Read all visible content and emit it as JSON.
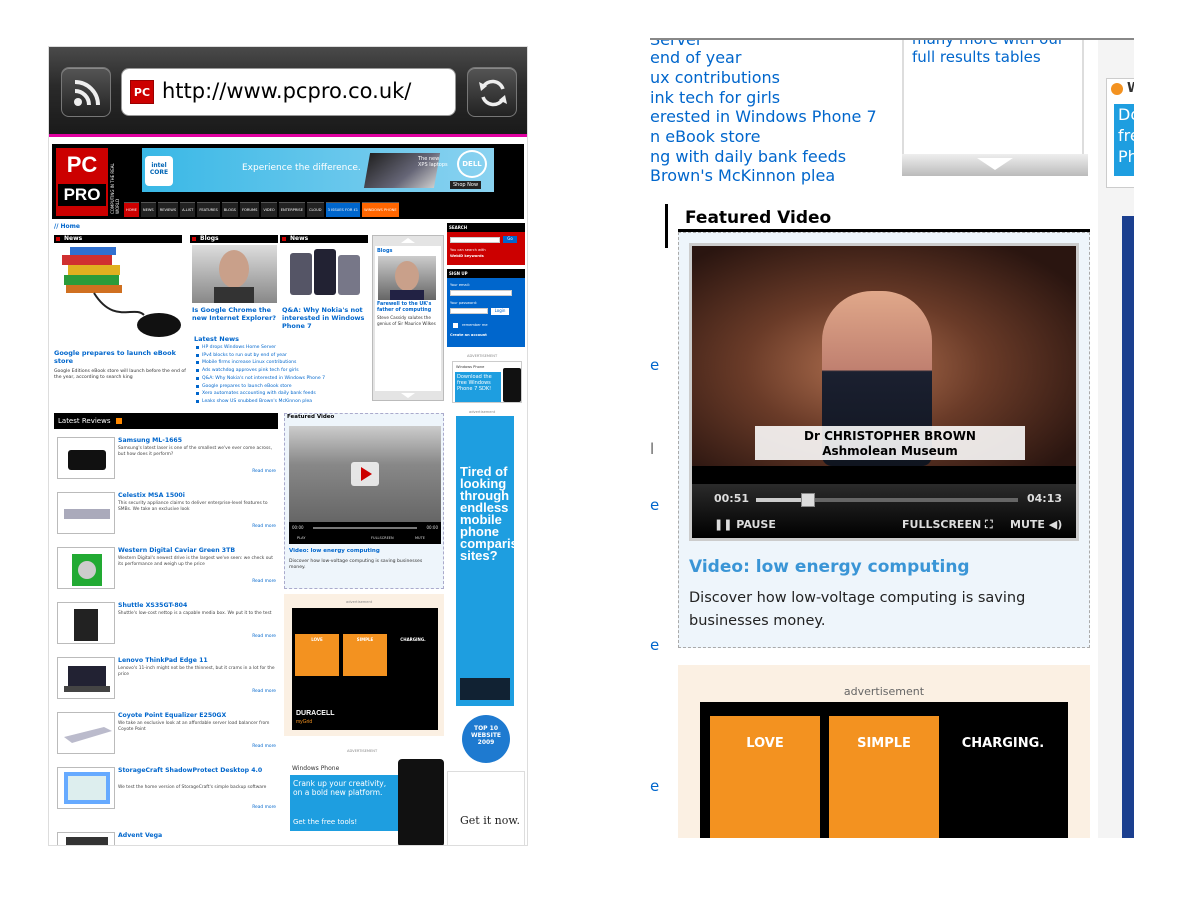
{
  "browser": {
    "url": "http://www.pcpro.co.uk/",
    "favicon_text": "PC"
  },
  "site": {
    "logo_top": "PC",
    "logo_bottom": "PRO",
    "tagline": "COMPUTING IN THE REAL WORLD",
    "banner": {
      "chip": "intel CORE",
      "headline": "Experience the difference.",
      "sub": "The new XPS laptops",
      "brand": "DELL",
      "cta": "Shop Now"
    },
    "nav": [
      "HOME",
      "NEWS",
      "REVIEWS",
      "A-LIST",
      "FEATURES",
      "BLOGS",
      "FORUMS",
      "VIDEO",
      "ENTERPRISE",
      "CLOUD",
      "3 ISSUES FOR £1",
      "WINDOWS PHONE"
    ],
    "breadcrumb": "// Home"
  },
  "news": {
    "heading": "News",
    "lead_title": "Google prepares to launch eBook store",
    "lead_desc": "Google Editions eBook store will launch before the end of the year, according to search king"
  },
  "blogs": {
    "heading": "Blogs",
    "title": "Is Google Chrome the new Internet Explorer?"
  },
  "news2": {
    "heading": "News",
    "title": "Q&A: Why Nokia's not interested in Windows Phone 7"
  },
  "latest_news": {
    "heading": "Latest News",
    "items": [
      "HP drops Windows Home Server",
      "IPv4 blocks to run out by end of year",
      "Mobile firms increase Linux contributions",
      "Ads watchdog approves pink tech for girls",
      "Q&A: Why Nokia's not interested in Windows Phone 7",
      "Google prepares to launch eBook store",
      "Xero automates accounting with daily bank feeds",
      "Leaks show US snubbed Brown's McKinnon plea"
    ]
  },
  "carousel": {
    "heading": "Blogs",
    "title": "Farewell to the UK's father of computing",
    "desc": "Steve Cassidy salutes the genius of Sir Maurice Wilkes"
  },
  "search": {
    "heading": "SEARCH",
    "go": "Go",
    "hint": "You can search with",
    "hint2": "WebID keywords"
  },
  "signup": {
    "heading": "SIGN UP",
    "email_label": "Your email:",
    "password_label": "Your password:",
    "login": "Login",
    "remember": "remember me",
    "create": "Create an account"
  },
  "ads": {
    "label": "ADVERTISEMENT",
    "label_lower": "advertisement",
    "wp_brand": "Windows Phone",
    "wp_small_text": "Download the free Windows Phone 7 SDK!",
    "tired_text": "Tired of looking through endless mobile phone comparison sites?",
    "top10": "TOP 10 WEBSITE",
    "top10_year": "2009",
    "wp_big_text": "Crank up your creativity, on a bold new platform.",
    "wp_big_cta": "Get the free tools!",
    "get_it": "Get it now.",
    "duracell": "DURACELL",
    "duracell_sub": "myGrid",
    "tiles": [
      "LOVE",
      "SIMPLE",
      "CHARGING."
    ]
  },
  "reviews": {
    "heading": "Latest Reviews",
    "read_more": "Read more",
    "items": [
      {
        "title": "Samsung ML-1665",
        "desc": "Samsung's latest laser is one of the smallest we've ever come across, but how does it perform?"
      },
      {
        "title": "Celestix MSA 1500i",
        "desc": "This security appliance claims to deliver enterprise-level features to SMBs. We take an exclusive look"
      },
      {
        "title": "Western Digital Caviar Green 3TB",
        "desc": "Western Digital's newest drive is the largest we've seen: we check out its performance and weigh up the price"
      },
      {
        "title": "Shuttle XS35GT-804",
        "desc": "Shuttle's low-cost nettop is a capable media box. We put it to the test"
      },
      {
        "title": "Lenovo ThinkPad Edge 11",
        "desc": "Lenovo's 11-inch might not be the thinnest, but it crams in a lot for the price"
      },
      {
        "title": "Coyote Point Equalizer E250GX",
        "desc": "We take an exclusive look at an affordable server load balancer from Coyote Point"
      },
      {
        "title": "StorageCraft ShadowProtect Desktop 4.0",
        "desc": "We test the home version of StorageCraft's simple backup software"
      },
      {
        "title": "Advent Vega",
        "desc": ""
      }
    ]
  },
  "featured_video": {
    "heading": "Featured Video",
    "title": "Video: low energy computing",
    "desc": "Discover how low-voltage computing is saving businesses money.",
    "caption_name": "Dr CHRISTOPHER BROWN",
    "caption_org": "Ashmolean Museum",
    "time_elapsed": "00:51",
    "time_total": "04:13",
    "time_elapsed_small": "00:00",
    "time_total_small": "00:00",
    "play": "PLAY",
    "pause": "PAUSE",
    "fullscreen": "FULLSCREEN",
    "mute": "MUTE",
    "progress": 0.2
  },
  "zoomed": {
    "left_fragments": [
      "Server",
      "end of year",
      "ux contributions",
      "ink tech for girls",
      "erested in Windows Phone 7",
      "n eBook store",
      "ng with daily bank feeds",
      "Brown's McKinnon plea"
    ],
    "box_text_1": "many more with our",
    "box_text_2": "full results tables",
    "side_stub": "e",
    "side_stub_l": "l",
    "wp_stub": "Do fre Ph",
    "wp_stub_w": "W"
  }
}
